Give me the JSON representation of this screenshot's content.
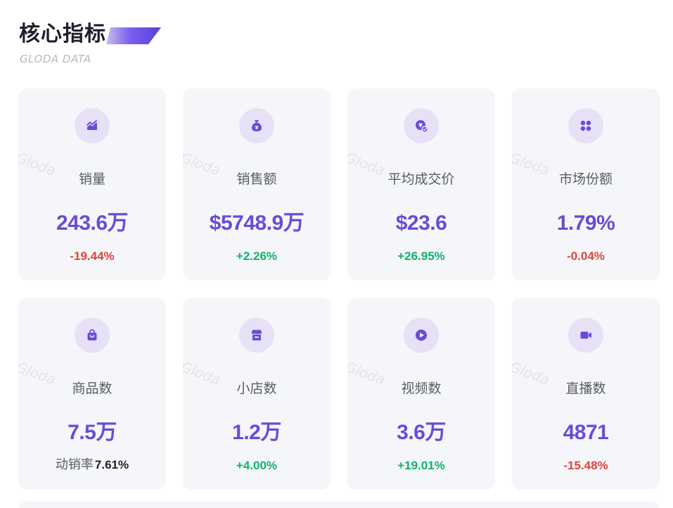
{
  "header": {
    "title": "核心指标",
    "subtitle": "GLODA DATA"
  },
  "watermark": "Gloda",
  "colors": {
    "accent": "#6a4bd8",
    "negative": "#e2443c",
    "positive": "#0fb26e",
    "card_bg": "#f5f6f9",
    "icon_bg": "#e6e1f7"
  },
  "cards": [
    {
      "label": "销量",
      "value": "243.6万",
      "change": "-19.44%",
      "trend": "neg",
      "icon": "trend-chart-icon"
    },
    {
      "label": "销售额",
      "value": "$5748.9万",
      "change": "+2.26%",
      "trend": "pos",
      "icon": "money-bag-icon"
    },
    {
      "label": "平均成交价",
      "value": "$23.6",
      "change": "+26.95%",
      "trend": "pos",
      "icon": "price-coin-icon"
    },
    {
      "label": "市场份额",
      "value": "1.79%",
      "change": "-0.04%",
      "trend": "neg",
      "icon": "grid-apps-icon"
    },
    {
      "label": "商品数",
      "value": "7.5万",
      "sub_label": "动销率",
      "sub_value": "7.61%",
      "icon": "shopping-bag-icon"
    },
    {
      "label": "小店数",
      "value": "1.2万",
      "change": "+4.00%",
      "trend": "pos",
      "icon": "store-icon"
    },
    {
      "label": "视频数",
      "value": "3.6万",
      "change": "+19.01%",
      "trend": "pos",
      "icon": "play-icon"
    },
    {
      "label": "直播数",
      "value": "4871",
      "change": "-15.48%",
      "trend": "neg",
      "icon": "video-camera-icon"
    }
  ]
}
